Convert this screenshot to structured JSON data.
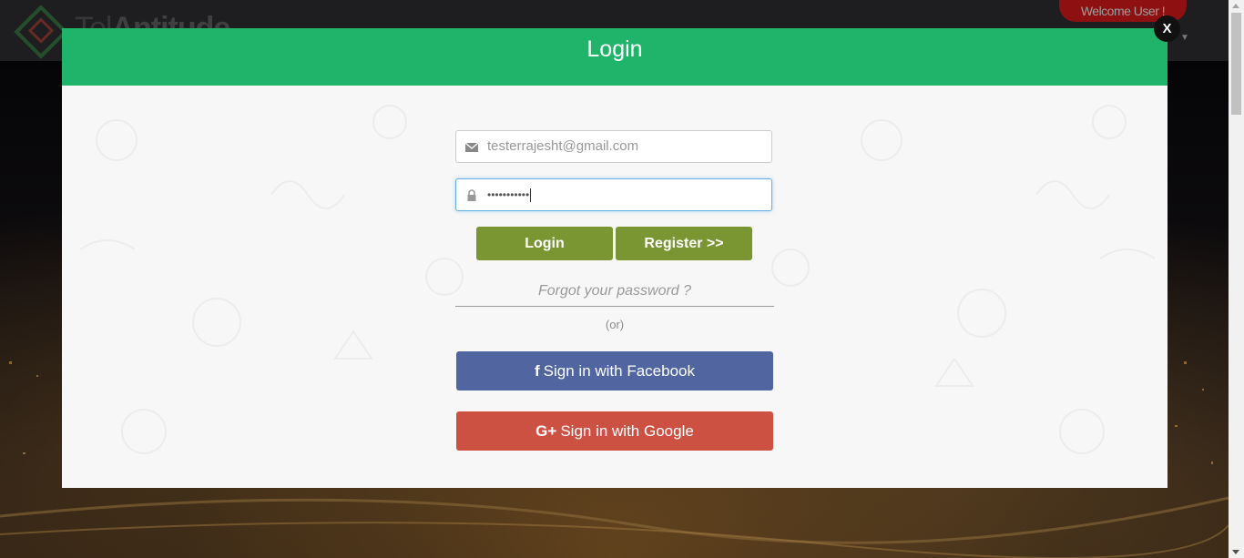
{
  "background": {
    "logo_text_light": "Tel",
    "logo_text_bold": "Antitude",
    "welcome_text": "Welcome User !"
  },
  "modal": {
    "title": "Login",
    "close_label": "X",
    "email": {
      "value": "testerrajesht@gmail.com",
      "icon": "envelope-icon"
    },
    "password": {
      "masked_value": "•••••••••••",
      "icon": "lock-icon"
    },
    "login_button": "Login",
    "register_button": "Register >>",
    "forgot_link": "Forgot your password ?",
    "or_text": "(or)",
    "facebook_button": {
      "icon": "f",
      "label": "Sign in with Facebook"
    },
    "google_button": {
      "icon": "G+",
      "label": "Sign in with Google"
    }
  },
  "colors": {
    "header_green": "#1fb46a",
    "button_olive": "#7a9632",
    "facebook_blue": "#5166a0",
    "google_red": "#cd5143",
    "focus_border": "#66afe9"
  }
}
